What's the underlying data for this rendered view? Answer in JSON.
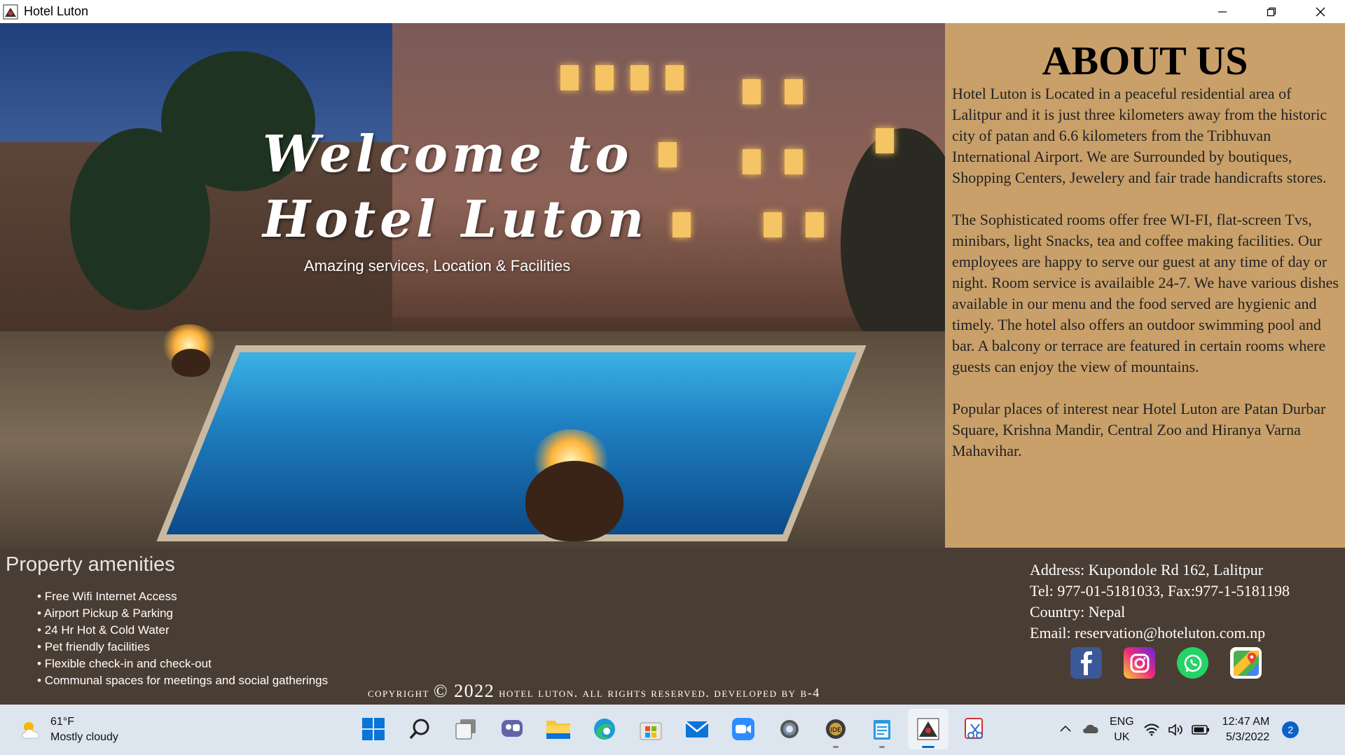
{
  "window": {
    "title": "Hotel Luton"
  },
  "hero": {
    "title_line1": "Welcome to",
    "title_line2": "Hotel Luton",
    "subtitle": "Amazing services, Location & Facilities"
  },
  "about": {
    "heading": "ABOUT US",
    "paragraphs": [
      "Hotel Luton is Located in a peaceful residential area of Lalitpur and it is just three kilometers away from the historic city of patan and 6.6 kilometers from the Tribhuvan International Airport. We are Surrounded by boutiques, Shopping Centers, Jewelery and fair trade handicrafts stores.",
      "The Sophisticated rooms offer free WI-FI, flat-screen Tvs, minibars, light Snacks, tea and coffee making facilities. Our employees are happy to serve our guest at any time of day or night. Room service is availaible 24-7. We have various dishes available in our menu and the food served are hygienic and timely. The hotel also offers an outdoor swimming pool and bar. A balcony or terrace are featured in certain rooms where guests can enjoy the view of mountains.",
      "Popular places of interest near Hotel Luton are Patan Durbar Square, Krishna Mandir, Central Zoo and Hiranya Varna Mahavihar."
    ]
  },
  "amenities": {
    "title": "Property amenities",
    "items": [
      "Free Wifi Internet Access",
      "Airport Pickup & Parking",
      "24 Hr Hot & Cold Water",
      "Pet friendly facilities",
      "Flexible check-in and check-out",
      "Communal spaces for meetings and social gatherings"
    ]
  },
  "contact": {
    "address": "Address: Kupondole Rd 162, Lalitpur",
    "tel": "Tel: 977-01-5181033, Fax:977-1-5181198",
    "country": "Country: Nepal",
    "email": "Email: reservation@hoteluton.com.np"
  },
  "social": [
    {
      "name": "facebook-icon",
      "color": "#3b5998",
      "glyph": "f"
    },
    {
      "name": "instagram-icon",
      "color": "#d6249f",
      "glyph": "◎"
    },
    {
      "name": "whatsapp-icon",
      "color": "#25d366",
      "glyph": "✆"
    },
    {
      "name": "maps-icon",
      "color": "#34a853",
      "glyph": "⚲"
    }
  ],
  "copyright": {
    "prefix": "copyright",
    "symbol_year": "© 2022",
    "suffix": "hotel luton. all rights reserved. developed by b-4"
  },
  "taskbar": {
    "weather_temp": "61°F",
    "weather_desc": "Mostly cloudy",
    "lang_1": "ENG",
    "lang_2": "UK",
    "time": "12:47 AM",
    "date": "5/3/2022",
    "notifications": "2"
  },
  "colors": {
    "about_bg": "#c9a06a",
    "footer_bg": "#4a3d33",
    "taskbar_bg": "#dde5ef"
  }
}
